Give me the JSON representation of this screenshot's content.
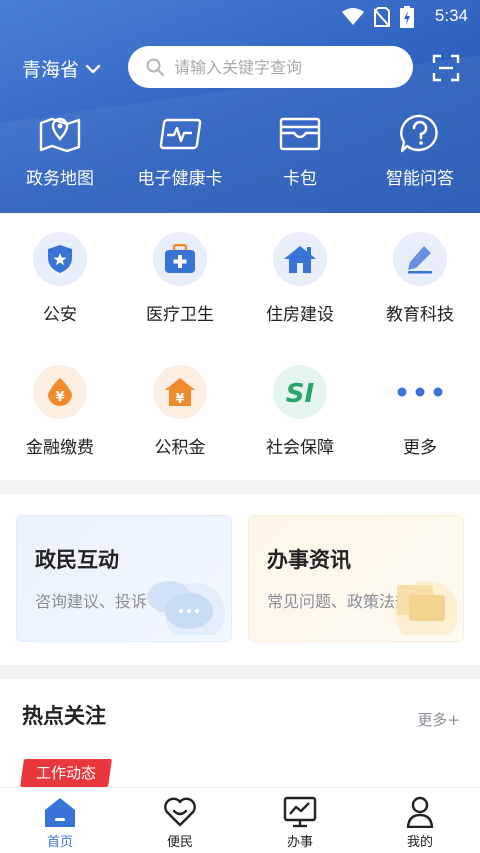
{
  "status": {
    "time": "5:34"
  },
  "header": {
    "region": "青海省",
    "search_placeholder": "请输入关键字查询"
  },
  "quick_actions": [
    {
      "label": "政务地图",
      "icon": "map-pin-icon"
    },
    {
      "label": "电子健康卡",
      "icon": "health-card-icon"
    },
    {
      "label": "卡包",
      "icon": "wallet-icon"
    },
    {
      "label": "智能问答",
      "icon": "question-chat-icon"
    }
  ],
  "services": [
    {
      "label": "公安",
      "icon": "police-shield-icon"
    },
    {
      "label": "医疗卫生",
      "icon": "medical-kit-icon"
    },
    {
      "label": "住房建设",
      "icon": "house-icon"
    },
    {
      "label": "教育科技",
      "icon": "pencil-icon"
    },
    {
      "label": "金融缴费",
      "icon": "yuan-coin-icon"
    },
    {
      "label": "公积金",
      "icon": "yuan-house-icon"
    },
    {
      "label": "社会保障",
      "icon": "si-icon",
      "icon_text": "SI"
    },
    {
      "label": "更多",
      "icon": "more-dots-icon"
    }
  ],
  "cards": [
    {
      "title": "政民互动",
      "subtitle": "咨询建议、投诉"
    },
    {
      "title": "办事资讯",
      "subtitle": "常见问题、政策法规"
    }
  ],
  "hot": {
    "title": "热点关注",
    "more": "更多+",
    "tag": "工作动态"
  },
  "tabs": [
    {
      "label": "首页",
      "icon": "home-icon",
      "active": true
    },
    {
      "label": "便民",
      "icon": "heart-smile-icon"
    },
    {
      "label": "办事",
      "icon": "monitor-chart-icon"
    },
    {
      "label": "我的",
      "icon": "person-icon"
    }
  ],
  "colors": {
    "primary": "#3a73d6",
    "header": "#2f62c0",
    "tag": "#e8373d"
  }
}
